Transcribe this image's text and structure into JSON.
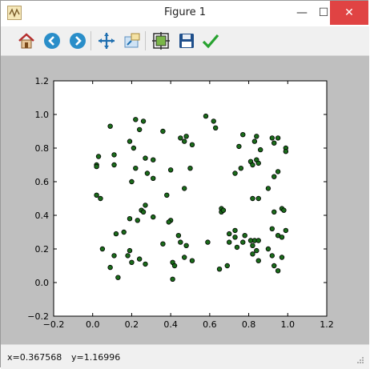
{
  "window": {
    "title": "Figure 1"
  },
  "titlebar_controls": {
    "minimize": "—",
    "maximize": "☐",
    "close": "✕"
  },
  "toolbar": {
    "buttons": [
      {
        "name": "home-icon"
      },
      {
        "name": "back-icon"
      },
      {
        "name": "forward-icon"
      },
      {
        "name": "pan-icon"
      },
      {
        "name": "zoom-icon"
      },
      {
        "name": "subplots-icon"
      },
      {
        "name": "save-icon"
      },
      {
        "name": "edit-icon"
      }
    ]
  },
  "status": {
    "x": "x=0.367568",
    "y": "y=1.16996"
  },
  "chart_data": {
    "type": "scatter",
    "xlim": [
      -0.2,
      1.2
    ],
    "ylim": [
      -0.2,
      1.2
    ],
    "xticks": [
      "−0.2",
      "0.0",
      "0.2",
      "0.4",
      "0.6",
      "0.8",
      "1.0",
      "1.2"
    ],
    "yticks": [
      "−0.2",
      "0.0",
      "0.2",
      "0.4",
      "0.6",
      "0.8",
      "1.0",
      "1.2"
    ],
    "grid": false,
    "colors": {
      "marker_fill": "#1a6b1a",
      "marker_edge": "#000000"
    },
    "points": [
      [
        0.09,
        0.93
      ],
      [
        0.22,
        0.97
      ],
      [
        0.26,
        0.96
      ],
      [
        0.24,
        0.91
      ],
      [
        0.58,
        0.99
      ],
      [
        0.62,
        0.96
      ],
      [
        0.63,
        0.92
      ],
      [
        0.36,
        0.9
      ],
      [
        0.45,
        0.86
      ],
      [
        0.48,
        0.87
      ],
      [
        0.47,
        0.84
      ],
      [
        0.51,
        0.82
      ],
      [
        0.19,
        0.84
      ],
      [
        0.21,
        0.8
      ],
      [
        0.03,
        0.75
      ],
      [
        0.11,
        0.76
      ],
      [
        0.27,
        0.74
      ],
      [
        0.31,
        0.73
      ],
      [
        0.02,
        0.7
      ],
      [
        0.02,
        0.69
      ],
      [
        0.11,
        0.7
      ],
      [
        0.22,
        0.68
      ],
      [
        0.28,
        0.65
      ],
      [
        0.31,
        0.62
      ],
      [
        0.2,
        0.6
      ],
      [
        0.4,
        0.67
      ],
      [
        0.5,
        0.68
      ],
      [
        0.47,
        0.56
      ],
      [
        0.77,
        0.88
      ],
      [
        0.84,
        0.87
      ],
      [
        0.83,
        0.84
      ],
      [
        0.75,
        0.81
      ],
      [
        0.86,
        0.79
      ],
      [
        0.84,
        0.73
      ],
      [
        0.85,
        0.71
      ],
      [
        0.76,
        0.68
      ],
      [
        0.73,
        0.65
      ],
      [
        0.81,
        0.72
      ],
      [
        0.82,
        0.7
      ],
      [
        0.92,
        0.86
      ],
      [
        0.95,
        0.86
      ],
      [
        0.93,
        0.83
      ],
      [
        0.99,
        0.8
      ],
      [
        0.99,
        0.78
      ],
      [
        0.95,
        0.66
      ],
      [
        0.93,
        0.63
      ],
      [
        0.02,
        0.52
      ],
      [
        0.04,
        0.5
      ],
      [
        0.38,
        0.52
      ],
      [
        0.27,
        0.46
      ],
      [
        0.25,
        0.43
      ],
      [
        0.26,
        0.42
      ],
      [
        0.19,
        0.38
      ],
      [
        0.31,
        0.39
      ],
      [
        0.4,
        0.37
      ],
      [
        0.39,
        0.36
      ],
      [
        0.66,
        0.44
      ],
      [
        0.66,
        0.42
      ],
      [
        0.67,
        0.43
      ],
      [
        0.82,
        0.5
      ],
      [
        0.85,
        0.5
      ],
      [
        0.9,
        0.56
      ],
      [
        0.97,
        0.44
      ],
      [
        0.98,
        0.43
      ],
      [
        0.93,
        0.42
      ],
      [
        0.16,
        0.3
      ],
      [
        0.12,
        0.29
      ],
      [
        0.23,
        0.37
      ],
      [
        0.19,
        0.19
      ],
      [
        0.18,
        0.16
      ],
      [
        0.05,
        0.2
      ],
      [
        0.11,
        0.16
      ],
      [
        0.09,
        0.09
      ],
      [
        0.13,
        0.03
      ],
      [
        0.2,
        0.12
      ],
      [
        0.24,
        0.14
      ],
      [
        0.27,
        0.11
      ],
      [
        0.44,
        0.28
      ],
      [
        0.45,
        0.24
      ],
      [
        0.48,
        0.22
      ],
      [
        0.36,
        0.23
      ],
      [
        0.41,
        0.12
      ],
      [
        0.42,
        0.1
      ],
      [
        0.47,
        0.15
      ],
      [
        0.51,
        0.13
      ],
      [
        0.41,
        0.02
      ],
      [
        0.59,
        0.24
      ],
      [
        0.7,
        0.29
      ],
      [
        0.73,
        0.31
      ],
      [
        0.73,
        0.27
      ],
      [
        0.78,
        0.28
      ],
      [
        0.74,
        0.21
      ],
      [
        0.77,
        0.24
      ],
      [
        0.7,
        0.24
      ],
      [
        0.65,
        0.08
      ],
      [
        0.69,
        0.1
      ],
      [
        0.83,
        0.25
      ],
      [
        0.84,
        0.19
      ],
      [
        0.81,
        0.25
      ],
      [
        0.82,
        0.17
      ],
      [
        0.85,
        0.13
      ],
      [
        0.82,
        0.22
      ],
      [
        0.85,
        0.25
      ],
      [
        0.92,
        0.32
      ],
      [
        0.9,
        0.2
      ],
      [
        0.92,
        0.16
      ],
      [
        0.95,
        0.28
      ],
      [
        0.97,
        0.27
      ],
      [
        0.99,
        0.31
      ],
      [
        0.97,
        0.15
      ],
      [
        0.93,
        0.1
      ],
      [
        0.95,
        0.07
      ]
    ]
  }
}
